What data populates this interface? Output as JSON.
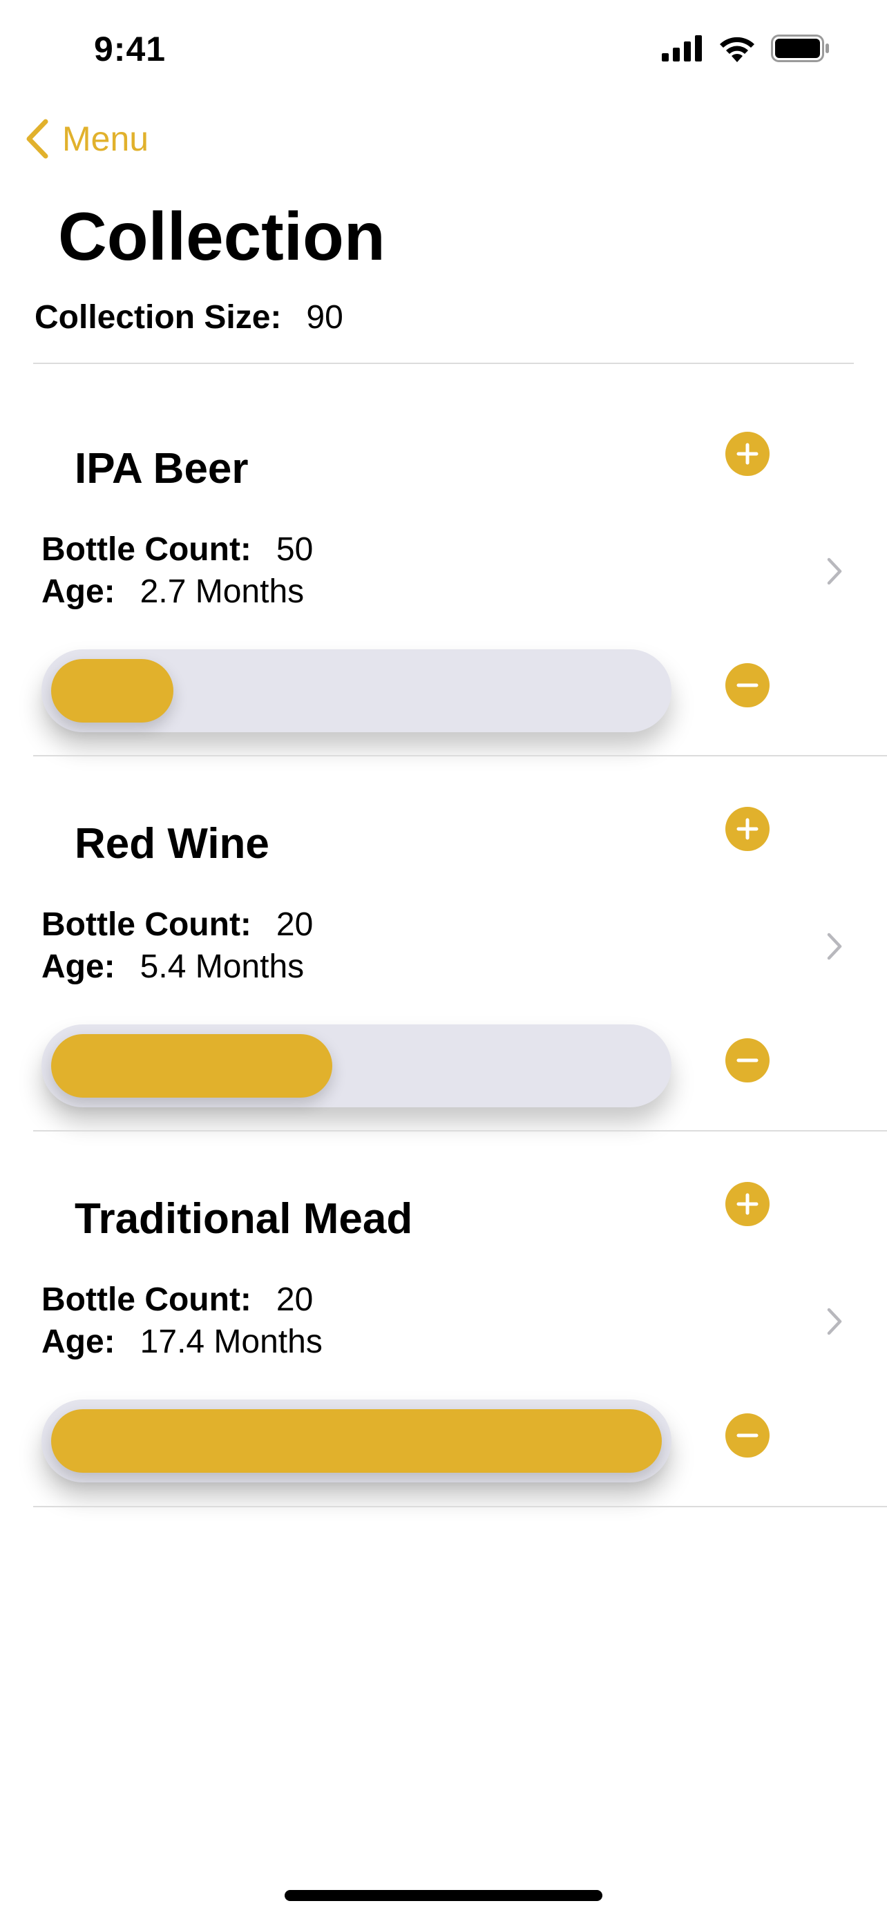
{
  "status_bar": {
    "time": "9:41"
  },
  "nav": {
    "back_label": "Menu"
  },
  "page": {
    "title": "Collection"
  },
  "summary": {
    "label": "Collection Size:",
    "value": "90"
  },
  "accent_color": "#e1b12c",
  "items": [
    {
      "name": "IPA Beer",
      "count_label": "Bottle Count:",
      "count_value": "50",
      "age_label": "Age:",
      "age_value": "2.7 Months",
      "age_level": 0.2
    },
    {
      "name": "Red Wine",
      "count_label": "Bottle Count:",
      "count_value": "20",
      "age_label": "Age:",
      "age_value": "5.4 Months",
      "age_level": 0.46
    },
    {
      "name": "Traditional Mead",
      "count_label": "Bottle Count:",
      "count_value": "20",
      "age_label": "Age:",
      "age_value": "17.4 Months",
      "age_level": 1.0
    }
  ]
}
